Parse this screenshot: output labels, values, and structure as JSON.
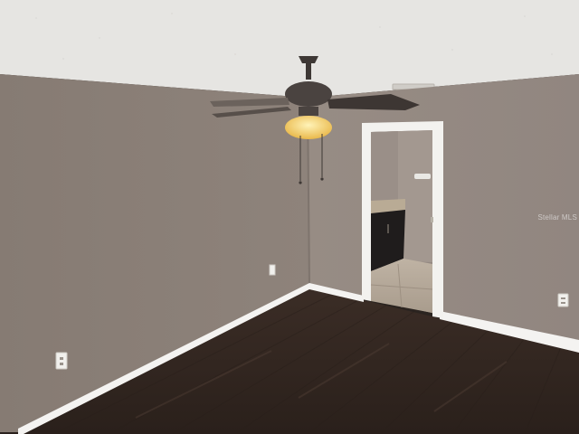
{
  "scene": {
    "description_tag": "empty-room-interior",
    "watermark_text": "Stellar MLS",
    "colors": {
      "wall_left": "#8b8078",
      "wall_back": "#958a82",
      "ceiling": "#e6e5e2",
      "floor": "#3a2c25",
      "baseboard": "#f4f3f1",
      "door_trim": "#f3f2ef",
      "fan_body": "#4a4340",
      "fan_light": "#f4cf6a"
    }
  }
}
